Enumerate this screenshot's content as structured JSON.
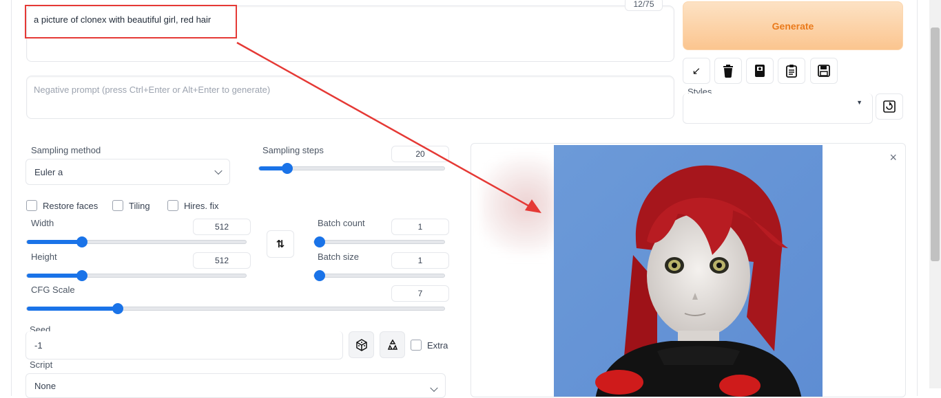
{
  "prompt": {
    "value": "a picture of clonex with beautiful girl, red hair",
    "token_counter": "12/75"
  },
  "negative_prompt": {
    "placeholder": "Negative prompt (press Ctrl+Enter or Alt+Enter to generate)"
  },
  "generate_label": "Generate",
  "tools": [
    {
      "icon": "arrow-diagonal-icon",
      "glyph": "↙"
    },
    {
      "icon": "trash-icon",
      "glyph": ""
    },
    {
      "icon": "card-icon",
      "glyph": ""
    },
    {
      "icon": "clipboard-icon",
      "glyph": ""
    },
    {
      "icon": "save-icon",
      "glyph": ""
    }
  ],
  "styles": {
    "label": "Styles",
    "value": ""
  },
  "sampling": {
    "method_label": "Sampling method",
    "method_value": "Euler a",
    "steps_label": "Sampling steps",
    "steps_value": "20",
    "steps_fraction": 0.13
  },
  "checkboxes": {
    "restore_faces": "Restore faces",
    "tiling": "Tiling",
    "hires_fix": "Hires. fix"
  },
  "width": {
    "label": "Width",
    "value": "512",
    "fraction": 0.24
  },
  "height": {
    "label": "Height",
    "value": "512",
    "fraction": 0.24
  },
  "batch_count": {
    "label": "Batch count",
    "value": "1",
    "fraction": 0.0
  },
  "batch_size": {
    "label": "Batch size",
    "value": "1",
    "fraction": 0.0
  },
  "cfg": {
    "label": "CFG Scale",
    "value": "7",
    "fraction": 0.21
  },
  "seed": {
    "label": "Seed",
    "value": "-1",
    "extra_label": "Extra"
  },
  "script": {
    "label": "Script",
    "value": "None"
  },
  "colors": {
    "accent": "#1a73e8",
    "generate_text": "#ea7a1b",
    "annotation": "#e53935"
  }
}
